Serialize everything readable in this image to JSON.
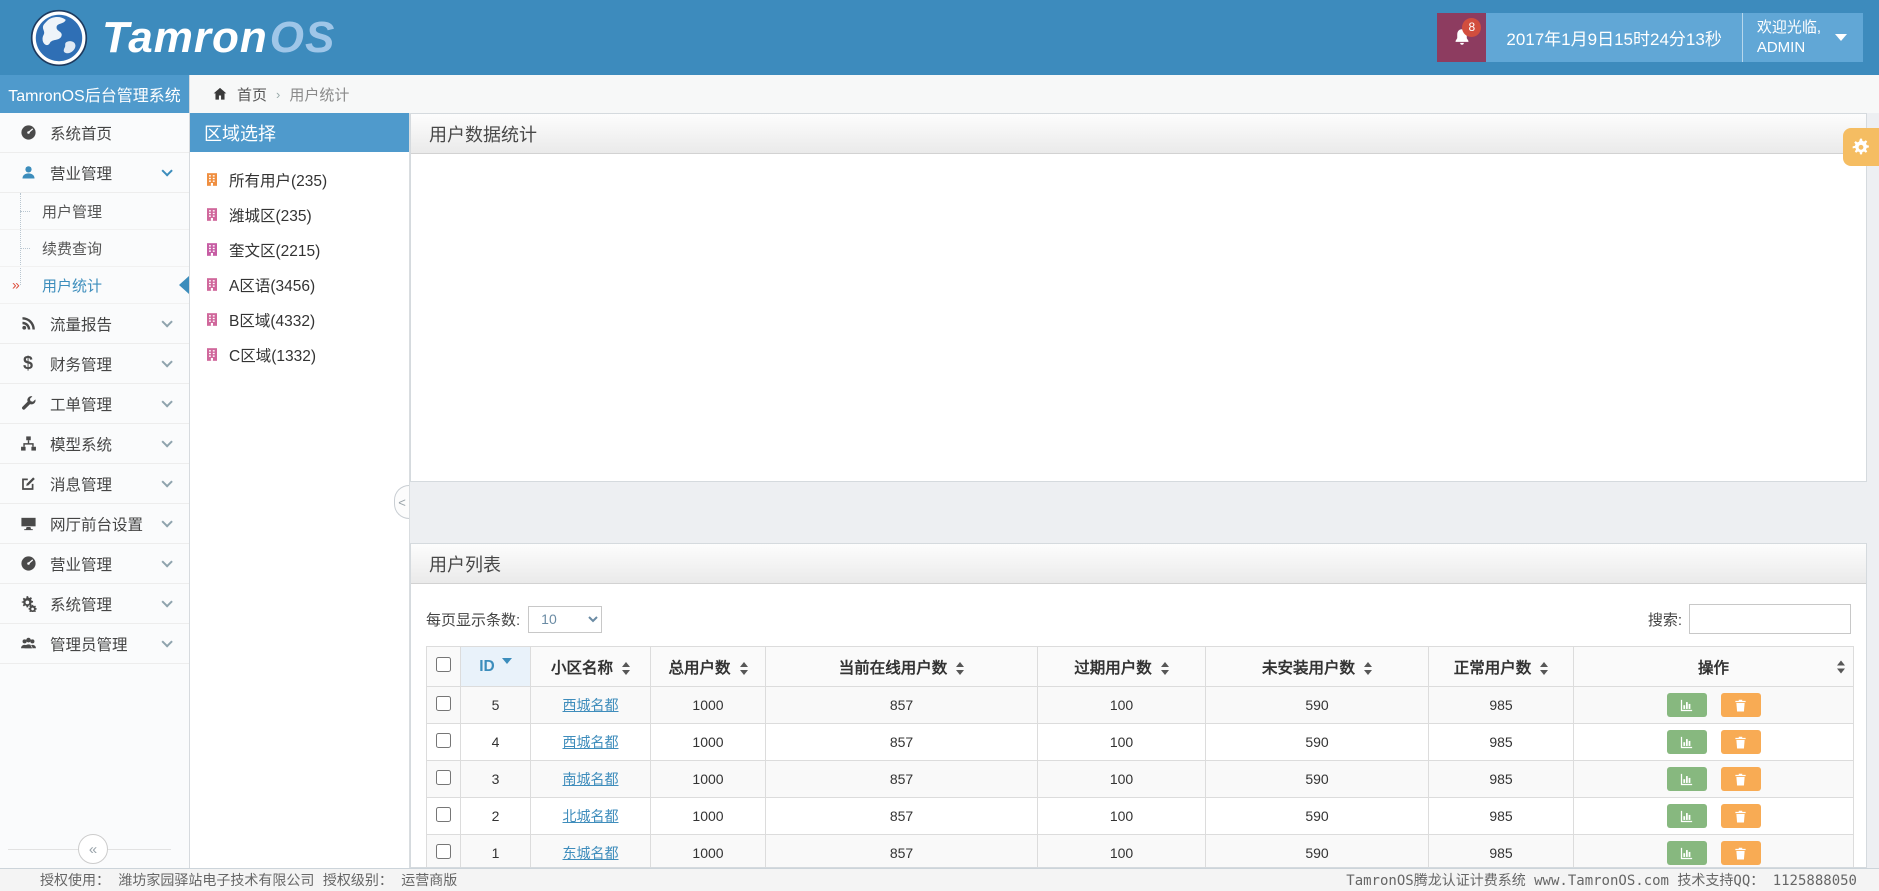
{
  "header": {
    "logo": {
      "part1": "Tamron",
      "part2": "OS"
    },
    "notifications": {
      "badge": "8"
    },
    "datetime": "2017年1月9日15时24分13秒",
    "welcome_line1": "欢迎光临,",
    "welcome_line2": "ADMIN"
  },
  "sidebar": {
    "title": "TamronOS后台管理系统",
    "collapse_glyph": "«",
    "items": [
      {
        "label": "系统首页",
        "icon": "gauge",
        "chevron": false
      },
      {
        "label": "营业管理",
        "icon": "user",
        "chevron": true,
        "expanded": true,
        "children": [
          {
            "label": "用户管理"
          },
          {
            "label": "续费查询"
          },
          {
            "label": "用户统计",
            "active": true
          }
        ]
      },
      {
        "label": "流量报告",
        "icon": "rss",
        "chevron": true
      },
      {
        "label": "财务管理",
        "icon": "dollar",
        "chevron": true
      },
      {
        "label": "工单管理",
        "icon": "wrench",
        "chevron": true
      },
      {
        "label": "模型系统",
        "icon": "sitemap",
        "chevron": true
      },
      {
        "label": "消息管理",
        "icon": "edit",
        "chevron": true
      },
      {
        "label": "网厅前台设置",
        "icon": "desktop",
        "chevron": true
      },
      {
        "label": "营业管理",
        "icon": "gauge",
        "chevron": true
      },
      {
        "label": "系统管理",
        "icon": "gears",
        "chevron": true
      },
      {
        "label": "管理员管理",
        "icon": "users",
        "chevron": true
      }
    ]
  },
  "breadcrumb": {
    "home": "首页",
    "separator": "›",
    "current": "用户统计"
  },
  "region_panel": {
    "title": "区域选择",
    "collapse_glyph": "<",
    "items": [
      {
        "label": "所有用户(235)",
        "color": "#ef8f41"
      },
      {
        "label": "潍城区(235)",
        "color": "#d0689c"
      },
      {
        "label": "奎文区(2215)",
        "color": "#c75da4"
      },
      {
        "label": "A区语(3456)",
        "color": "#d0689c"
      },
      {
        "label": "B区域(4332)",
        "color": "#d0689c"
      },
      {
        "label": "C区域(1332)",
        "color": "#d0689c"
      }
    ]
  },
  "stats_panel": {
    "title": "用户数据统计"
  },
  "list_panel": {
    "title": "用户列表",
    "page_size_label": "每页显示条数:",
    "page_size_value": "10",
    "search_label": "搜索:"
  },
  "table": {
    "columns": [
      {
        "key": "checkbox",
        "label": ""
      },
      {
        "key": "id",
        "label": "ID",
        "sorted": "desc"
      },
      {
        "key": "name",
        "label": "小区名称",
        "sortable": true
      },
      {
        "key": "total",
        "label": "总用户数",
        "sortable": true
      },
      {
        "key": "online",
        "label": "当前在线用户数",
        "sortable": true
      },
      {
        "key": "expired",
        "label": "过期用户数",
        "sortable": true
      },
      {
        "key": "uninstalled",
        "label": "未安装用户数",
        "sortable": true
      },
      {
        "key": "normal",
        "label": "正常用户数",
        "sortable": true
      },
      {
        "key": "actions",
        "label": "操作",
        "sortable": true
      }
    ],
    "rows": [
      {
        "id": "5",
        "name": "西城名都",
        "total": "1000",
        "online": "857",
        "expired": "100",
        "uninstalled": "590",
        "normal": "985"
      },
      {
        "id": "4",
        "name": "西城名都",
        "total": "1000",
        "online": "857",
        "expired": "100",
        "uninstalled": "590",
        "normal": "985"
      },
      {
        "id": "3",
        "name": "南城名都",
        "total": "1000",
        "online": "857",
        "expired": "100",
        "uninstalled": "590",
        "normal": "985"
      },
      {
        "id": "2",
        "name": "北城名都",
        "total": "1000",
        "online": "857",
        "expired": "100",
        "uninstalled": "590",
        "normal": "985"
      },
      {
        "id": "1",
        "name": "东城名都",
        "total": "1000",
        "online": "857",
        "expired": "100",
        "uninstalled": "590",
        "normal": "985"
      }
    ]
  },
  "footer": {
    "left": "授权使用： 潍坊家园驿站电子技术有限公司  授权级别： 运营商版",
    "right": "TamronOS腾龙认证计费系统 www.TamronOS.com 技术支持QQ： 1125888050"
  },
  "colors": {
    "header_blue": "#3d8bbd",
    "panel_header_blue": "#4f9acc",
    "accent": "#3c8dbc",
    "bell_bg": "#8d3c60",
    "badge": "#d24e3e",
    "chart_button": "#87b87f",
    "delete_button": "#f8ab54"
  }
}
